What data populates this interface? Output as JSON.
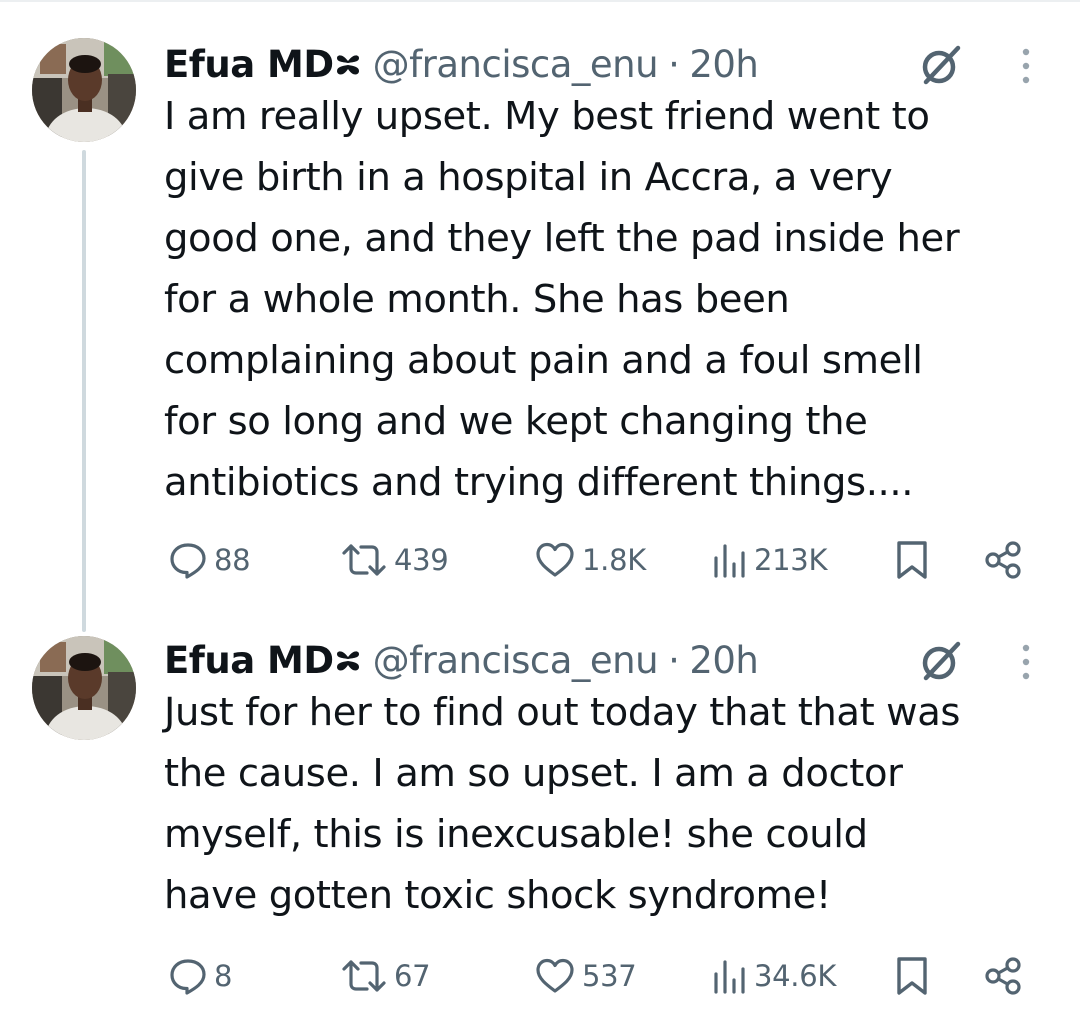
{
  "colors": {
    "text": "#0f1419",
    "secondary": "#536471",
    "thread_line": "#cfd9de"
  },
  "tweets": [
    {
      "author": {
        "name": "Efua MD",
        "badge_icon": "heart-badge-icon",
        "handle": "@francisca_enu",
        "separator": "·",
        "time": "20h"
      },
      "lines": [
        "I am really upset. My best friend went to",
        "give birth in a hospital in Accra, a very",
        "good one, and they left the pad inside her",
        "for a whole month. She has been",
        "complaining about pain and a foul smell",
        "for so long and we kept changing the",
        "antibiotics and trying different things...."
      ],
      "stats": {
        "replies": "88",
        "reposts": "439",
        "likes": "1.8K",
        "views": "213K"
      }
    },
    {
      "author": {
        "name": "Efua MD",
        "badge_icon": "heart-badge-icon",
        "handle": "@francisca_enu",
        "separator": "·",
        "time": "20h"
      },
      "lines": [
        "Just for her to find out today that that was",
        "the cause. I am so upset. I am a doctor",
        "myself, this is inexcusable! she could",
        "have gotten toxic shock syndrome!"
      ],
      "stats": {
        "replies": "8",
        "reposts": "67",
        "likes": "537",
        "views": "34.6K"
      }
    }
  ]
}
